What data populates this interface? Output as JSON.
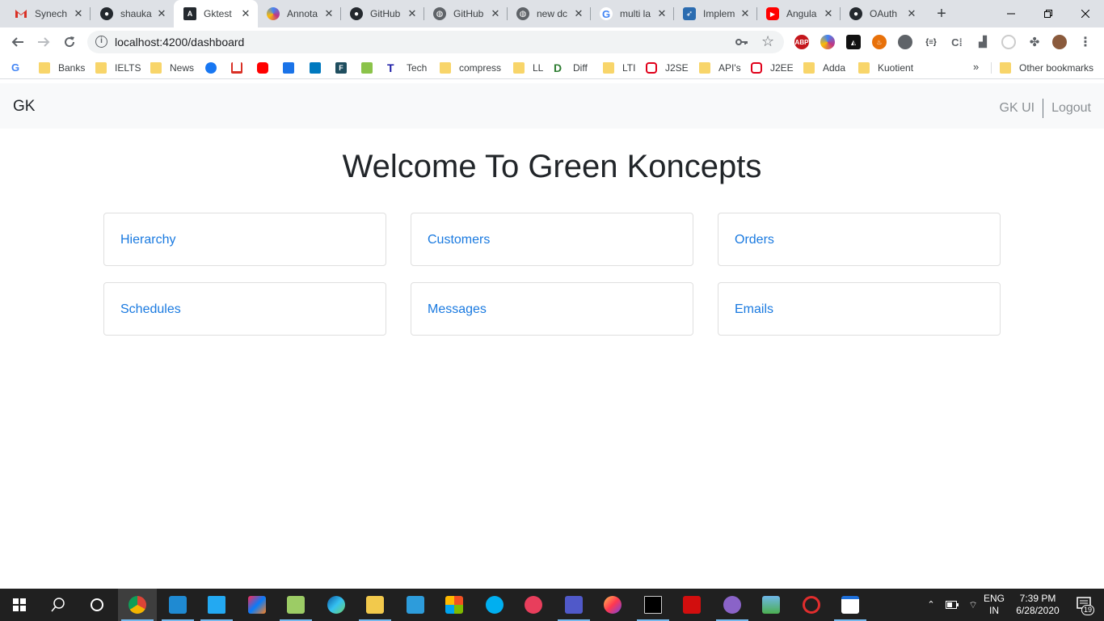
{
  "browser": {
    "tabs": [
      {
        "title": "Synech",
        "icon": "gmail-icon",
        "color": "#d93025"
      },
      {
        "title": "shauka",
        "icon": "github-icon",
        "color": "#24292e"
      },
      {
        "title": "Gktest",
        "icon": "angular-icon",
        "color": "#24292e"
      },
      {
        "title": "Annota",
        "icon": "annotation-icon",
        "color": "#c13584"
      },
      {
        "title": "GitHub",
        "icon": "github-icon",
        "color": "#24292e"
      },
      {
        "title": "GitHub",
        "icon": "globe-icon",
        "color": "#5f6368"
      },
      {
        "title": "new dc",
        "icon": "globe-icon",
        "color": "#5f6368"
      },
      {
        "title": "multi la",
        "icon": "google-icon",
        "color": "#4285f4"
      },
      {
        "title": "Implem",
        "icon": "bird-icon",
        "color": "#2b6cb0"
      },
      {
        "title": "Angula",
        "icon": "youtube-icon",
        "color": "#ff0000"
      },
      {
        "title": "OAuth",
        "icon": "github-icon",
        "color": "#24292e"
      }
    ],
    "address": "localhost:4200/dashboard",
    "bookmarks": [
      {
        "label": "",
        "type": "google"
      },
      {
        "label": "Banks",
        "type": "folder"
      },
      {
        "label": "IELTS",
        "type": "folder"
      },
      {
        "label": "News",
        "type": "folder"
      },
      {
        "label": "",
        "type": "facebook"
      },
      {
        "label": "",
        "type": "gmail"
      },
      {
        "label": "",
        "type": "youtube"
      },
      {
        "label": "",
        "type": "pocket"
      },
      {
        "label": "",
        "type": "trello"
      },
      {
        "label": "",
        "type": "f-app"
      },
      {
        "label": "",
        "type": "chart"
      },
      {
        "label": "Tech",
        "type": "tech"
      },
      {
        "label": "compress",
        "type": "folder"
      },
      {
        "label": "LL",
        "type": "folder"
      },
      {
        "label": "Diff",
        "type": "diff"
      },
      {
        "label": "LTI",
        "type": "folder"
      },
      {
        "label": "J2SE",
        "type": "oracle"
      },
      {
        "label": "API's",
        "type": "folder"
      },
      {
        "label": "J2EE",
        "type": "oracle"
      },
      {
        "label": "Adda",
        "type": "folder"
      },
      {
        "label": "Kuotient",
        "type": "folder"
      }
    ],
    "more": "»",
    "other_bookmarks": "Other bookmarks"
  },
  "app": {
    "brand": "GK",
    "nav": {
      "gk_ui": "GK UI",
      "logout": "Logout"
    },
    "heading": "Welcome To Green Koncepts",
    "cards": [
      "Hierarchy",
      "Customers",
      "Orders",
      "Schedules",
      "Messages",
      "Emails"
    ]
  },
  "taskbar": {
    "lang": "ENG",
    "region": "IN",
    "time": "7:39 PM",
    "date": "6/28/2020",
    "notifications": "19"
  },
  "colors": {
    "link": "#1a7ae0",
    "nav_bg": "#f8f9fa",
    "taskbar": "#202020"
  }
}
